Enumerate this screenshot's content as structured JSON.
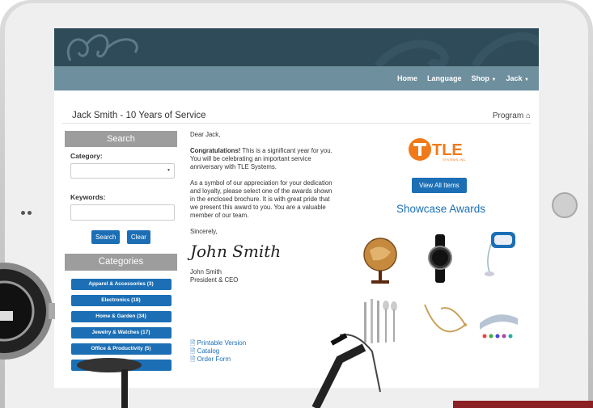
{
  "nav": {
    "home": "Home",
    "language": "Language",
    "shop": "Shop",
    "user": "Jack"
  },
  "page": {
    "title": "Jack Smith - 10 Years of Service",
    "program": "Program"
  },
  "search": {
    "heading": "Search",
    "category_label": "Category:",
    "keywords_label": "Keywords:",
    "search_btn": "Search",
    "clear_btn": "Clear"
  },
  "categories": {
    "heading": "Categories",
    "items": [
      "Apparel & Accessories (3)",
      "Electronics (18)",
      "Home & Garden (34)",
      "Jewelry & Watches (17)",
      "Office & Productivity (5)",
      "...ors (15)"
    ]
  },
  "letter": {
    "greeting": "Dear Jack,",
    "congrats_bold": "Congratulations!",
    "para1": " This is a significant year for you. You will be celebrating an important service anniversary with TLE Systems.",
    "para2": "As a symbol of our appreciation for your dedication and loyalty, please select one of the awards shown in the enclosed brochure. It is with great pride that we present this award to you. You are a valuable member of our team.",
    "closing": "Sincerely,",
    "signature": "John Smith",
    "signer_name": "John Smith",
    "signer_title": "President & CEO"
  },
  "links": {
    "printable": "Printable Version",
    "catalog": "Catalog",
    "order": "Order Form"
  },
  "brand": {
    "logo_text": "TLE",
    "logo_sub": "SYSTEMS, INC.",
    "accent": "#f07a1a"
  },
  "showcase": {
    "view_all": "View All Items",
    "heading": "Showcase Awards"
  },
  "colors": {
    "primary": "#1c6fb5",
    "banner": "#2f4a58",
    "navbar": "#6e8f9d",
    "sidebar_head": "#9d9d9d"
  }
}
